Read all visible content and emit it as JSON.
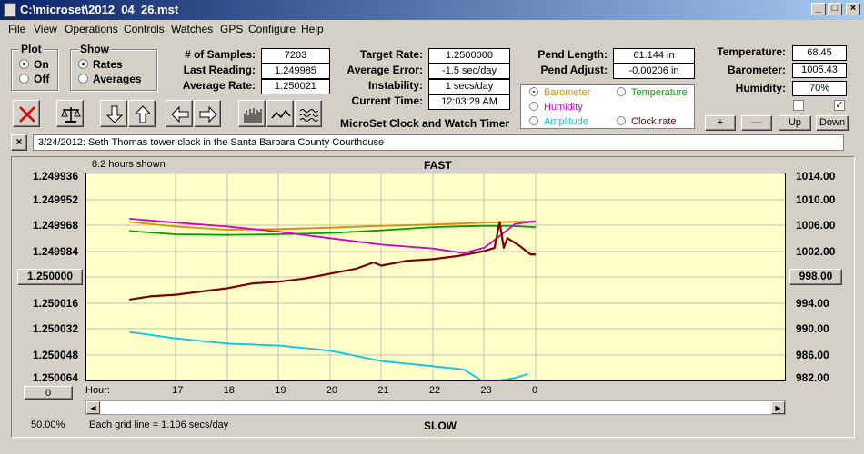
{
  "window": {
    "title": "C:\\microset\\2012_04_26.mst"
  },
  "menu": [
    "File",
    "View",
    "Operations",
    "Controls",
    "Watches",
    "GPS",
    "Configure",
    "Help"
  ],
  "plot_group": {
    "title": "Plot",
    "on": "On",
    "off": "Off",
    "selected": "On"
  },
  "show_group": {
    "title": "Show",
    "rates": "Rates",
    "averages": "Averages",
    "selected": "Rates"
  },
  "stats": {
    "samples_label": "# of Samples:",
    "samples": "7203",
    "last_label": "Last Reading:",
    "last": "1.249985",
    "avg_label": "Average Rate:",
    "avg": "1.250021",
    "target_label": "Target Rate:",
    "target": "1.2500000",
    "avgerr_label": "Average Error:",
    "avgerr": "-1.5 sec/day",
    "instab_label": "Instability:",
    "instab": "1 secs/day",
    "time_label": "Current Time:",
    "time": "12:03:29 AM",
    "pendlen_label": "Pend Length:",
    "pendlen": "61.144 in",
    "pendadj_label": "Pend Adjust:",
    "pendadj": "-0.00206 in",
    "temp_label": "Temperature:",
    "temp": "68.45",
    "baro_label": "Barometer:",
    "baro": "1005.43",
    "hum_label": "Humidity:",
    "hum": "70%"
  },
  "app_name": "MicroSet Clock and Watch Timer",
  "overlay": {
    "barometer": "Barometer",
    "temperature": "Temperature",
    "humidity": "Humidity",
    "amplitude": "Amplitude",
    "clockrate": "Clock rate",
    "selected": "Barometer"
  },
  "colors": {
    "barometer": "#e08a00",
    "temperature": "#00a000",
    "humidity": "#d000d0",
    "amplitude": "#00c8e8",
    "clockrate": "#7a0000"
  },
  "scale_buttons": {
    "plus": "+",
    "minus": "—",
    "up": "Up",
    "down": "Down"
  },
  "checkboxes": [
    false,
    true
  ],
  "note": {
    "close": "×",
    "text": "3/24/2012: Seth Thomas tower clock in the Santa Barbara County Courthouse"
  },
  "chart_header": {
    "hours_shown": "8.2 hours shown",
    "fast": "FAST",
    "slow": "SLOW",
    "hour_label": "Hour:",
    "grid_note": "Each grid line = 1.106 secs/day",
    "zoom": "50.00%"
  },
  "left_button": "1.250000",
  "right_button": "998.00",
  "bottom_button": "0",
  "chart_data": {
    "type": "line",
    "left_axis": {
      "ticks": [
        "1.249936",
        "1.249952",
        "1.249968",
        "1.249984",
        "1.250000",
        "1.250016",
        "1.250032",
        "1.250048",
        "1.250064"
      ],
      "range": [
        1.249936,
        1.250064
      ]
    },
    "right_axis": {
      "ticks": [
        "1014.00",
        "1010.00",
        "1006.00",
        "1002.00",
        "998.00",
        "994.00",
        "990.00",
        "986.00",
        "982.00"
      ],
      "range": [
        982,
        1014
      ]
    },
    "x_ticks": [
      "17",
      "18",
      "19",
      "20",
      "21",
      "22",
      "23",
      "0"
    ],
    "series": [
      {
        "key": "barometer",
        "axis": "right",
        "x": [
          16.1,
          17.0,
          18.0,
          19.0,
          20.0,
          21.0,
          22.0,
          23.0,
          23.5,
          24.0
        ],
        "values": [
          1006.5,
          1005.8,
          1005.3,
          1005.4,
          1005.6,
          1005.9,
          1006.1,
          1006.4,
          1006.5,
          1006.6
        ]
      },
      {
        "key": "temperature",
        "axis": "right",
        "x": [
          16.1,
          17.0,
          18.0,
          19.0,
          20.0,
          21.0,
          22.0,
          23.0,
          23.5,
          24.0
        ],
        "values": [
          1005.1,
          1004.6,
          1004.5,
          1004.6,
          1004.8,
          1005.2,
          1005.7,
          1005.9,
          1005.9,
          1005.7
        ]
      },
      {
        "key": "humidity",
        "axis": "right",
        "x": [
          16.1,
          17.0,
          18.0,
          19.0,
          20.0,
          21.0,
          22.0,
          22.6,
          23.0,
          23.3,
          23.6,
          24.0
        ],
        "values": [
          1007.0,
          1006.4,
          1005.8,
          1005.0,
          1004.0,
          1003.0,
          1002.4,
          1001.7,
          1002.5,
          1004.3,
          1006.2,
          1006.6
        ]
      },
      {
        "key": "amplitude",
        "axis": "right",
        "x": [
          16.1,
          17.0,
          18.0,
          19.0,
          20.0,
          21.0,
          22.0,
          22.6,
          22.95,
          23.3,
          23.6,
          23.85
        ],
        "values": [
          989.5,
          988.5,
          987.7,
          987.4,
          986.6,
          985.0,
          984.2,
          983.7,
          982.0,
          982.0,
          982.4,
          983.0
        ]
      },
      {
        "key": "clockrate",
        "axis": "left",
        "x": [
          16.1,
          16.5,
          17.0,
          17.5,
          18.0,
          18.5,
          19.0,
          19.5,
          20.0,
          20.5,
          20.85,
          21.0,
          21.5,
          22.0,
          22.5,
          23.0,
          23.2,
          23.3,
          23.38,
          23.45,
          23.55,
          23.7,
          23.9,
          24.0
        ],
        "values": [
          1.250014,
          1.250012,
          1.250011,
          1.250009,
          1.250007,
          1.250004,
          1.250003,
          1.250001,
          1.249998,
          1.249995,
          1.249991,
          1.249993,
          1.24999,
          1.249989,
          1.249987,
          1.249984,
          1.249982,
          1.249966,
          1.249982,
          1.249976,
          1.249978,
          1.249981,
          1.249986,
          1.249986
        ]
      }
    ]
  }
}
